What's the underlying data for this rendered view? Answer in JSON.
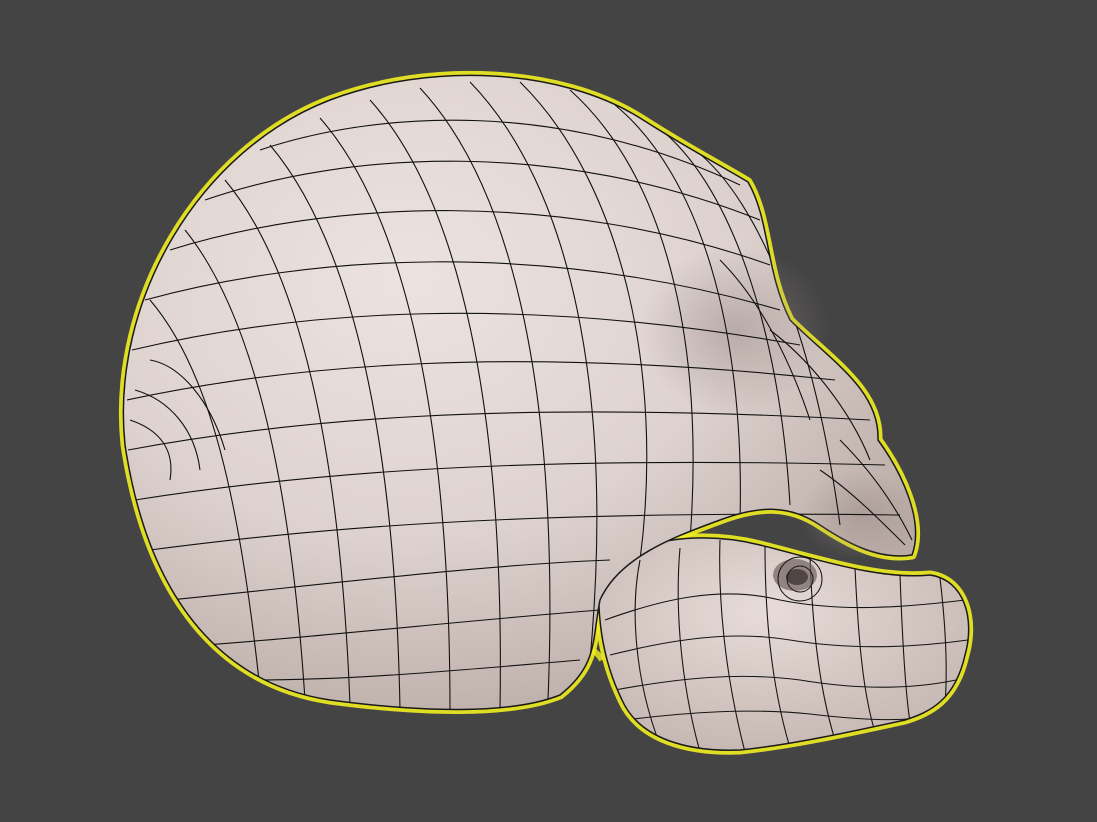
{
  "viewport": {
    "background": "#444444",
    "selection_outline_color": "#f2ee22",
    "mesh_fill_color": "#e3d8d4",
    "wireframe_color": "#111111"
  },
  "model": {
    "icon": "skull-wireframe-model",
    "selected": true
  }
}
